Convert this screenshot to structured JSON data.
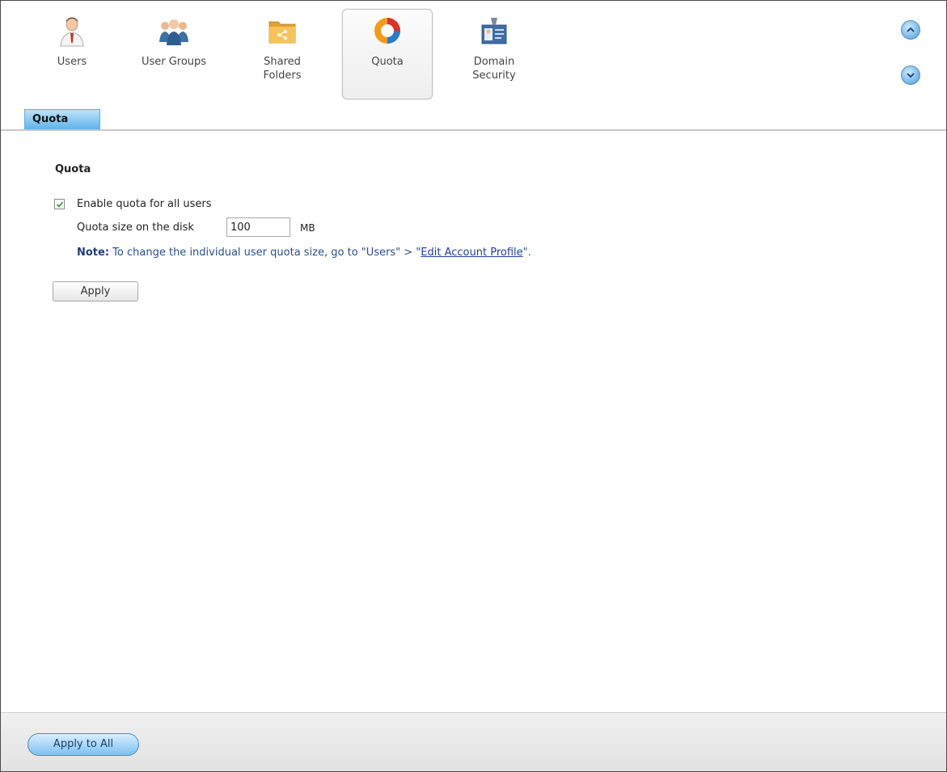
{
  "toolbar": {
    "items": [
      {
        "label": "Users",
        "icon": "user-icon"
      },
      {
        "label": "User Groups",
        "icon": "user-groups-icon"
      },
      {
        "label": "Shared\nFolders",
        "icon": "shared-folder-icon"
      },
      {
        "label": "Quota",
        "icon": "quota-icon",
        "selected": true
      },
      {
        "label": "Domain\nSecurity",
        "icon": "domain-security-icon"
      }
    ],
    "scroll_up_icon": "chevron-up-icon",
    "scroll_down_icon": "chevron-down-icon"
  },
  "tabs": [
    {
      "label": "Quota",
      "active": true
    }
  ],
  "content": {
    "section_title": "Quota",
    "enable_quota": {
      "label": "Enable quota for all users",
      "checked": true
    },
    "quota_size": {
      "label": "Quota size on the disk",
      "value": "100",
      "unit": "MB"
    },
    "note": {
      "prefix": "Note:",
      "text": " To change the individual user quota size, go to \"Users\" > \"",
      "link": "Edit Account Profile",
      "suffix": "\"."
    },
    "apply_label": "Apply"
  },
  "footer": {
    "apply_all_label": "Apply to All"
  },
  "colors": {
    "tab_active": "#5fb3ea",
    "note_text": "#2a4f8a",
    "footer_button": "#7ec0ef"
  }
}
